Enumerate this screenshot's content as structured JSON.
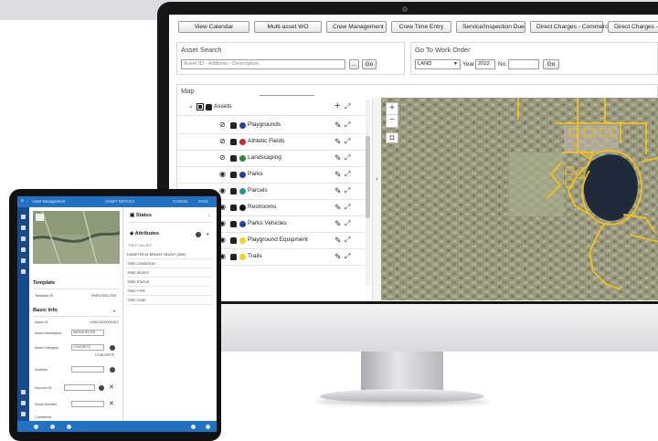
{
  "toolbar": {
    "buttons": [
      "View Calendar",
      "Multi-asset WO",
      "Crew Management",
      "Crew Time Entry",
      "Service/Inspection Due",
      "Direct Charges - Commercial",
      "Direct Charges - Labor"
    ]
  },
  "asset_search": {
    "title": "Asset Search",
    "placeholder": "Asset ID - Address - Description",
    "browse_label": "...",
    "go_label": "Go"
  },
  "work_order": {
    "title": "Go To Work Order",
    "type_value": "LAND",
    "year_label": "Year",
    "year_value": "2022",
    "no_label": "No.",
    "go_label": "Go"
  },
  "map": {
    "title": "Map",
    "root_layer": "Assets",
    "layers": [
      {
        "name": "Playgrounds",
        "color": "#2a3d9a",
        "visible": false
      },
      {
        "name": "Athletic Fields",
        "color": "#d2262a",
        "visible": false
      },
      {
        "name": "Landscaping",
        "color": "#2e8a3a",
        "visible": false
      },
      {
        "name": "Parks",
        "color": "#2a3d9a",
        "visible": true
      },
      {
        "name": "Parcels",
        "color": "#1f9a8c",
        "visible": true
      },
      {
        "name": "Restrooms",
        "color": "#111111",
        "visible": true
      },
      {
        "name": "Parks Vehicles",
        "color": "#2a3d9a",
        "visible": true
      },
      {
        "name": "Playground Equipment",
        "color": "#f2d21f",
        "visible": true
      },
      {
        "name": "Trails",
        "color": "#f2d21f",
        "visible": true
      }
    ]
  },
  "tablet": {
    "header_title": "Asset Management",
    "header_center": "ASSET DETAILS",
    "header_cancel": "CANCEL",
    "header_save": "SAVE",
    "template_section": "Template",
    "template_label": "Template ID",
    "template_value": "PARKSHELTER",
    "basic_info_section": "Basic Info",
    "asset_id_label": "Asset ID",
    "asset_id_value": "LAND15000001E2",
    "asset_desc_label": "Asset Description",
    "asset_desc_value": "PARKSHELTER",
    "asset_category_label": "Asset Category",
    "asset_category_value": "CONCRETE",
    "asset_category_hint": "CONCRETE",
    "address_label": "Address",
    "account_label": "Account ID",
    "serial_label": "Serial Number",
    "comments_label": "Comments",
    "status_section": "Status",
    "attributes_section": "Attributes",
    "tree_values_label": "TREE VALUES",
    "attribute_rows": [
      "DIAMETER AT BREAST HEIGHT (DBH)",
      "TREE CONDITION",
      "TREE HEIGHT",
      "TREE STATUS",
      "TREE TYPE",
      "TREE ZONE"
    ]
  }
}
